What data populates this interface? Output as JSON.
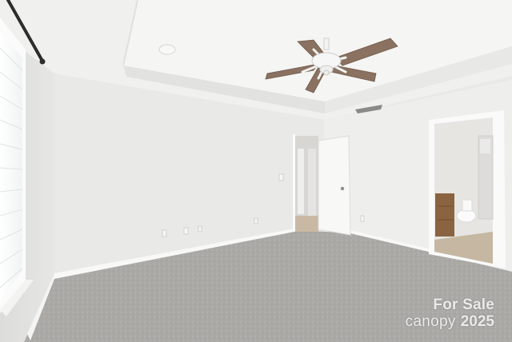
{
  "photo": {
    "scene": "empty bedroom with tray ceiling, ceiling fan, carpet and open doors",
    "colors": {
      "wall": "#ececea",
      "ceiling": "#f1f1ef",
      "carpet": "#aaa8a5",
      "trim": "#f7f7f5",
      "fan_blade": "#8a7160"
    }
  },
  "watermark": {
    "line1": "For Sale",
    "brand": "canopy",
    "year": "2025"
  }
}
